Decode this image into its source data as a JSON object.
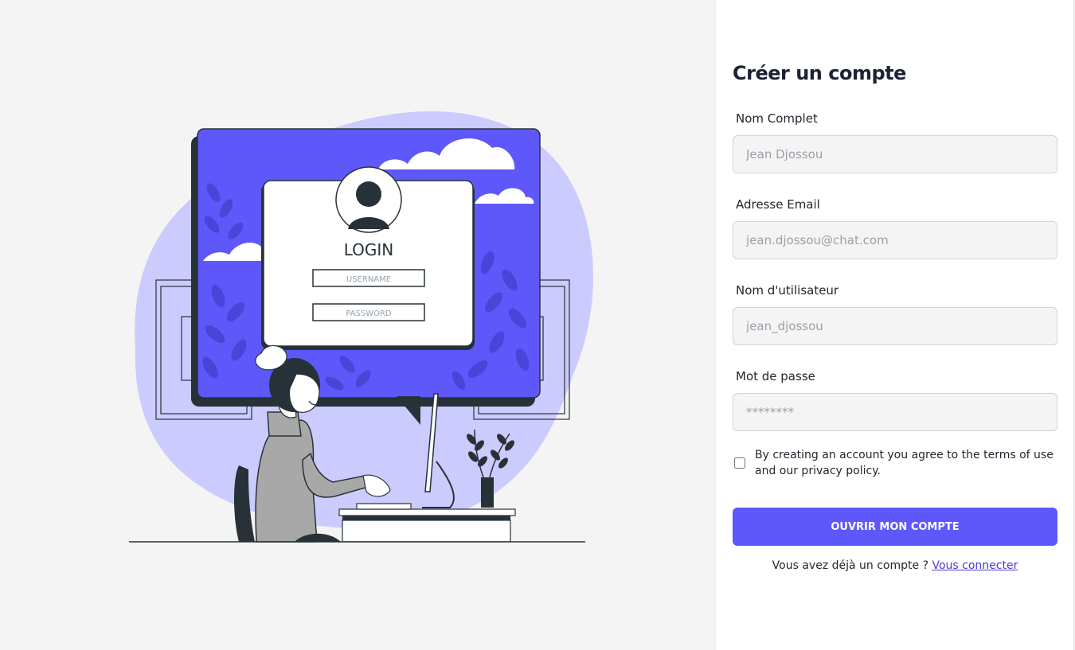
{
  "illustration": {
    "card_title": "LOGIN",
    "username_field": "USERNAME",
    "password_field": "PASSWORD"
  },
  "form": {
    "title": "Créer un compte",
    "fields": [
      {
        "label": "Nom Complet",
        "placeholder": "Jean Djossou",
        "value": ""
      },
      {
        "label": "Adresse Email",
        "placeholder": "jean.djossou@chat.com",
        "value": ""
      },
      {
        "label": "Nom d'utilisateur",
        "placeholder": "jean_djossou",
        "value": ""
      },
      {
        "label": "Mot de passe",
        "placeholder": "********",
        "value": ""
      }
    ],
    "terms_text": "By creating an account you agree to the terms of use and our privacy policy.",
    "terms_checked": false,
    "submit_label": "OUVRIR MON COMPTE",
    "login_prompt": "Vous avez déjà un compte ? ",
    "login_link": "Vous connecter"
  },
  "colors": {
    "accent": "#5e58fb",
    "blob": "#cccbfe",
    "page_background": "#f4f4f4",
    "dark": "#263238"
  }
}
